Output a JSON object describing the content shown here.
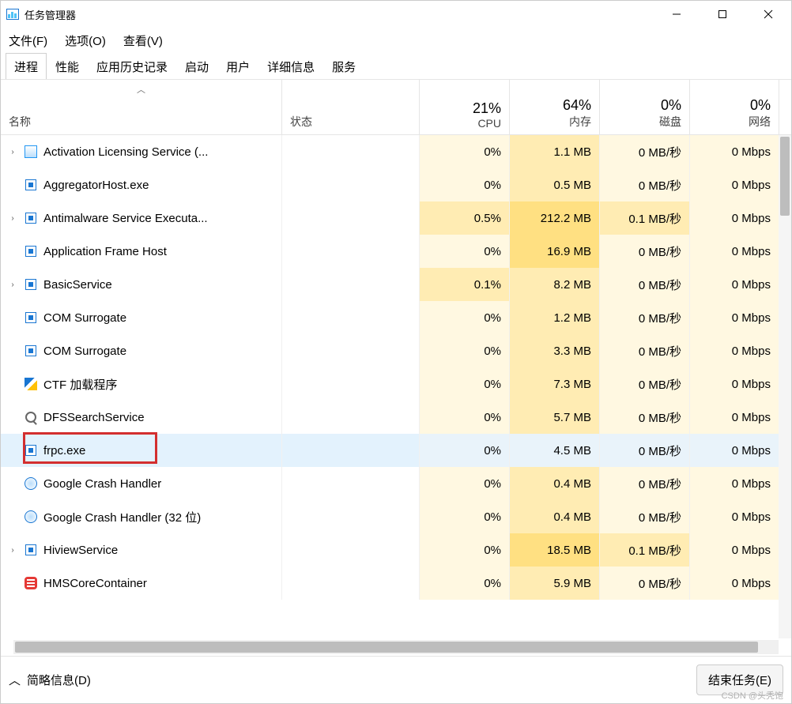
{
  "window": {
    "title": "任务管理器"
  },
  "menubar": {
    "file": "文件(F)",
    "options": "选项(O)",
    "view": "查看(V)"
  },
  "tabs": {
    "items": [
      "进程",
      "性能",
      "应用历史记录",
      "启动",
      "用户",
      "详细信息",
      "服务"
    ],
    "active_index": 0
  },
  "columns": {
    "name": "名称",
    "status": "状态",
    "cpu_pct": "21%",
    "cpu_label": "CPU",
    "mem_pct": "64%",
    "mem_label": "内存",
    "disk_pct": "0%",
    "disk_label": "磁盘",
    "net_pct": "0%",
    "net_label": "网络"
  },
  "processes": [
    {
      "name": "Activation Licensing Service (...",
      "cpu": "0%",
      "mem": "1.1 MB",
      "disk": "0 MB/秒",
      "net": "0 Mbps",
      "expandable": true,
      "icon": "generic",
      "mem_heat": "mid"
    },
    {
      "name": "AggregatorHost.exe",
      "cpu": "0%",
      "mem": "0.5 MB",
      "disk": "0 MB/秒",
      "net": "0 Mbps",
      "expandable": false,
      "icon": "blue-square",
      "mem_heat": "mid"
    },
    {
      "name": "Antimalware Service Executa...",
      "cpu": "0.5%",
      "mem": "212.2 MB",
      "disk": "0.1 MB/秒",
      "net": "0 Mbps",
      "expandable": true,
      "icon": "blue-square",
      "cpu_heat": "mid",
      "mem_heat": "high",
      "disk_heat": "mid"
    },
    {
      "name": "Application Frame Host",
      "cpu": "0%",
      "mem": "16.9 MB",
      "disk": "0 MB/秒",
      "net": "0 Mbps",
      "expandable": false,
      "icon": "blue-square",
      "mem_heat": "high"
    },
    {
      "name": "BasicService",
      "cpu": "0.1%",
      "mem": "8.2 MB",
      "disk": "0 MB/秒",
      "net": "0 Mbps",
      "expandable": true,
      "icon": "blue-square",
      "cpu_heat": "mid",
      "mem_heat": "mid"
    },
    {
      "name": "COM Surrogate",
      "cpu": "0%",
      "mem": "1.2 MB",
      "disk": "0 MB/秒",
      "net": "0 Mbps",
      "expandable": false,
      "icon": "blue-square",
      "mem_heat": "mid"
    },
    {
      "name": "COM Surrogate",
      "cpu": "0%",
      "mem": "3.3 MB",
      "disk": "0 MB/秒",
      "net": "0 Mbps",
      "expandable": false,
      "icon": "blue-square",
      "mem_heat": "mid"
    },
    {
      "name": "CTF 加载程序",
      "cpu": "0%",
      "mem": "7.3 MB",
      "disk": "0 MB/秒",
      "net": "0 Mbps",
      "expandable": false,
      "icon": "pen",
      "mem_heat": "mid"
    },
    {
      "name": "DFSSearchService",
      "cpu": "0%",
      "mem": "5.7 MB",
      "disk": "0 MB/秒",
      "net": "0 Mbps",
      "expandable": false,
      "icon": "search",
      "mem_heat": "mid"
    },
    {
      "name": "frpc.exe",
      "cpu": "0%",
      "mem": "4.5 MB",
      "disk": "0 MB/秒",
      "net": "0 Mbps",
      "expandable": false,
      "icon": "blue-square",
      "mem_heat": "mid",
      "selected": true,
      "highlighted": true
    },
    {
      "name": "Google Crash Handler",
      "cpu": "0%",
      "mem": "0.4 MB",
      "disk": "0 MB/秒",
      "net": "0 Mbps",
      "expandable": false,
      "icon": "globe",
      "mem_heat": "mid"
    },
    {
      "name": "Google Crash Handler (32 位)",
      "cpu": "0%",
      "mem": "0.4 MB",
      "disk": "0 MB/秒",
      "net": "0 Mbps",
      "expandable": false,
      "icon": "globe",
      "mem_heat": "mid"
    },
    {
      "name": "HiviewService",
      "cpu": "0%",
      "mem": "18.5 MB",
      "disk": "0.1 MB/秒",
      "net": "0 Mbps",
      "expandable": true,
      "icon": "blue-square",
      "mem_heat": "high",
      "disk_heat": "mid"
    },
    {
      "name": "HMSCoreContainer",
      "cpu": "0%",
      "mem": "5.9 MB",
      "disk": "0 MB/秒",
      "net": "0 Mbps",
      "expandable": false,
      "icon": "red",
      "mem_heat": "mid"
    }
  ],
  "footer": {
    "toggle_label": "简略信息(D)",
    "end_task": "结束任务(E)"
  },
  "watermark": "CSDN @头秃饱"
}
